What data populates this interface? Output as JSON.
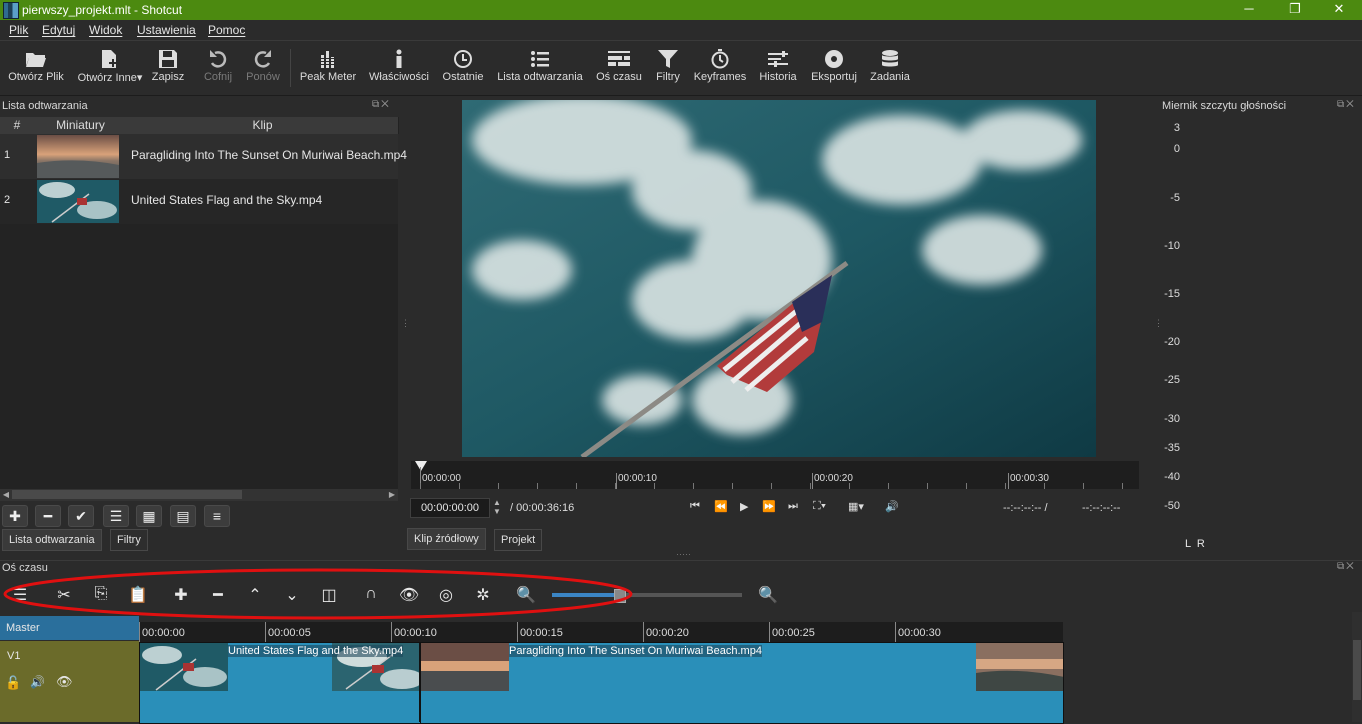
{
  "window": {
    "title": "pierwszy_projekt.mlt - Shotcut",
    "minimize": "─",
    "maximize": "❐",
    "close": "✕"
  },
  "menu": [
    "Plik",
    "Edytuj",
    "Widok",
    "Ustawienia",
    "Pomoc"
  ],
  "toolbar": [
    {
      "label": "Otwórz Plik",
      "icon": "folder-open-icon"
    },
    {
      "label": "Otwórz Inne",
      "icon": "add-file-icon"
    },
    {
      "label": "Zapisz",
      "icon": "save-icon"
    },
    {
      "label": "Cofnij",
      "icon": "undo-icon",
      "disabled": true
    },
    {
      "label": "Ponów",
      "icon": "redo-icon",
      "disabled": true
    },
    {
      "label": "Peak Meter",
      "icon": "peak-meter-icon"
    },
    {
      "label": "Właściwości",
      "icon": "info-icon"
    },
    {
      "label": "Ostatnie",
      "icon": "clock-icon"
    },
    {
      "label": "Lista odtwarzania",
      "icon": "list-icon"
    },
    {
      "label": "Oś czasu",
      "icon": "timeline-icon"
    },
    {
      "label": "Filtry",
      "icon": "filter-icon"
    },
    {
      "label": "Keyframes",
      "icon": "stopwatch-icon"
    },
    {
      "label": "Historia",
      "icon": "history-icon"
    },
    {
      "label": "Eksportuj",
      "icon": "export-icon"
    },
    {
      "label": "Zadania",
      "icon": "jobs-icon"
    }
  ],
  "playlist": {
    "title": "Lista odtwarzania",
    "columns": [
      "#",
      "Miniatury",
      "Klip"
    ],
    "rows": [
      {
        "num": "1",
        "clip": "Paragliding Into The Sunset On Muriwai Beach.mp4"
      },
      {
        "num": "2",
        "clip": "United States Flag and the Sky.mp4"
      }
    ],
    "tabs": [
      "Lista odtwarzania",
      "Filtry"
    ]
  },
  "player": {
    "ruler": [
      "00:00:00",
      "00:00:10",
      "00:00:20",
      "00:00:30"
    ],
    "position": "00:00:00:00",
    "duration": "/ 00:00:36:16",
    "in_out_left": "--:--:--:-- /",
    "in_out_right": "--:--:--:--",
    "tabs": [
      "Klip źródłowy",
      "Projekt"
    ]
  },
  "meter": {
    "title": "Miernik szczytu głośności",
    "levels": [
      "3",
      "0",
      "-5",
      "-10",
      "-15",
      "-20",
      "-25",
      "-30",
      "-35",
      "-40",
      "-50"
    ],
    "channels": "L  R"
  },
  "timeline": {
    "title": "Oś czasu",
    "ruler": [
      "00:00:00",
      "00:00:05",
      "00:00:10",
      "00:00:15",
      "00:00:20",
      "00:00:25",
      "00:00:30"
    ],
    "master": "Master",
    "track": "V1",
    "clips": [
      "United States Flag and the Sky.mp4",
      "Paragliding Into The Sunset On Muriwai Beach.mp4"
    ],
    "zoom_fraction": 0.35
  },
  "colors": {
    "titlebar": "#4c8a10",
    "clip": "#2a8fb9",
    "track_head": "#6b6b2a",
    "annotation": "#e01010"
  }
}
